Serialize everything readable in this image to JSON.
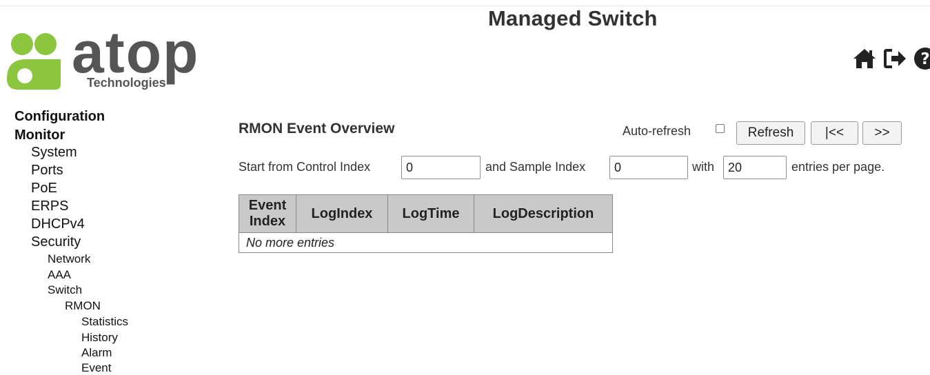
{
  "header": {
    "title": "Managed Switch",
    "logo": {
      "wordmark": "atop",
      "tagline": "Technologies",
      "accent_color": "#8cc63f",
      "text_color": "#555555"
    },
    "icons": [
      "home-icon",
      "logout-icon",
      "help-icon"
    ]
  },
  "nav": {
    "items": [
      {
        "label": "Configuration",
        "level": 0
      },
      {
        "label": "Monitor",
        "level": 0
      },
      {
        "label": "System",
        "level": 1
      },
      {
        "label": "Ports",
        "level": 1
      },
      {
        "label": "PoE",
        "level": 1
      },
      {
        "label": "ERPS",
        "level": 1
      },
      {
        "label": "DHCPv4",
        "level": 1
      },
      {
        "label": "Security",
        "level": 1
      },
      {
        "label": "Network",
        "level": 2
      },
      {
        "label": "AAA",
        "level": 2
      },
      {
        "label": "Switch",
        "level": 2
      },
      {
        "label": "RMON",
        "level": 3
      },
      {
        "label": "Statistics",
        "level": 4
      },
      {
        "label": "History",
        "level": 4
      },
      {
        "label": "Alarm",
        "level": 4
      },
      {
        "label": "Event",
        "level": 4
      }
    ]
  },
  "main": {
    "title": "RMON Event Overview",
    "auto_refresh_label": "Auto-refresh",
    "auto_refresh_checked": false,
    "buttons": {
      "refresh": "Refresh",
      "first": "|<<",
      "next": ">>"
    },
    "controls": {
      "start_label": "Start from Control Index",
      "control_index": "0",
      "sample_label": "and Sample Index",
      "sample_index": "0",
      "with_label": "with",
      "entries": "20",
      "entries_label": "entries per page."
    },
    "table": {
      "headers": {
        "event_index_line1": "Event",
        "event_index_line2": "Index",
        "log_index": "LogIndex",
        "log_time": "LogTime",
        "log_description": "LogDescription"
      },
      "empty_text": "No more entries"
    }
  }
}
